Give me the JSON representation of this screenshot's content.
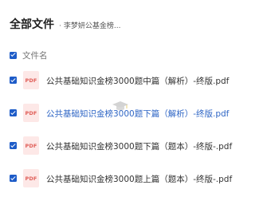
{
  "header": {
    "title": "全部文件",
    "separator": "·",
    "owner": "李梦妍公基金榜..."
  },
  "list": {
    "column_label": "文件名",
    "file_icon_label": "PDF",
    "files": [
      {
        "name": "公共基础知识金榜3000题中篇（解析）-终版.pdf",
        "checked": true
      },
      {
        "name": "公共基础知识金榜3000题下篇（解析）-终版.pdf",
        "checked": true
      },
      {
        "name": "公共基础知识金榜3000题下篇（题本）-终版-.pdf",
        "checked": true
      },
      {
        "name": "公共基础知识金榜3000题上篇（题本）-终版-.pdf",
        "checked": true
      }
    ]
  },
  "colors": {
    "checkbox": "#1e5cc8",
    "pdf_icon_bg": "#fde8e7",
    "pdf_icon_text": "#e0605a",
    "hover_text": "#2f66c5"
  }
}
